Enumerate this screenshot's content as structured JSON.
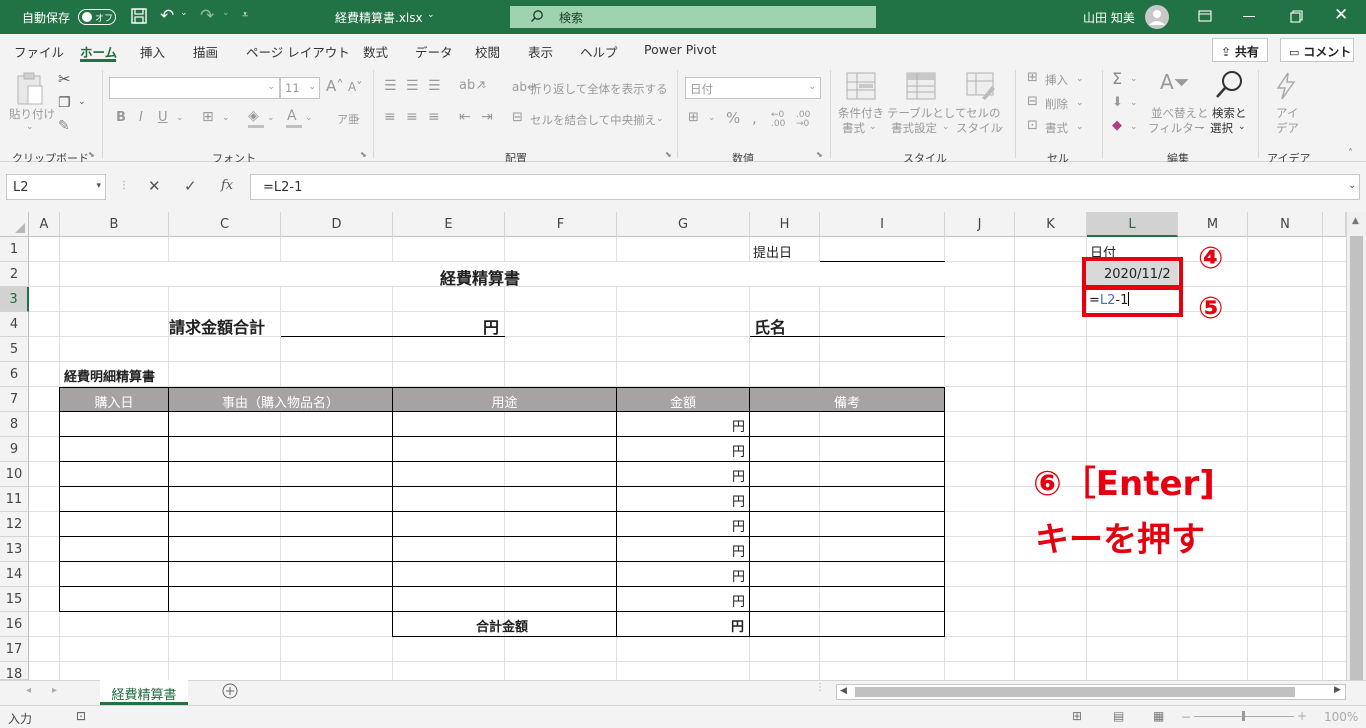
{
  "titlebar": {
    "autosave_label": "自動保存",
    "autosave_state": "オフ",
    "filename": "経費精算書.xlsx",
    "search_placeholder": "検索",
    "user_name": "山田 知美"
  },
  "tabs": [
    "ファイル",
    "ホーム",
    "挿入",
    "描画",
    "ページ レイアウト",
    "数式",
    "データ",
    "校閲",
    "表示",
    "ヘルプ",
    "Power Pivot"
  ],
  "active_tab": "ホーム",
  "share_label": "共有",
  "comment_label": "コメント",
  "ribbon": {
    "paste_label": "貼り付け",
    "font_size": "11",
    "wrap_text": "折り返して全体を表示する",
    "merge_center": "セルを結合して中央揃え",
    "number_format": "日付",
    "cond_format_1": "条件付き",
    "cond_format_2": "書式",
    "table_format_1": "テーブルとして",
    "table_format_2": "書式設定",
    "cell_style_1": "セルの",
    "cell_style_2": "スタイル",
    "insert": "挿入",
    "delete": "削除",
    "format": "書式",
    "sort_1": "並べ替えと",
    "sort_2": "フィルター",
    "find_1": "検索と",
    "find_2": "選択",
    "ideas_1": "アイ",
    "ideas_2": "デア",
    "groups": {
      "clipboard": "クリップボード",
      "font": "フォント",
      "alignment": "配置",
      "number": "数値",
      "styles": "スタイル",
      "cells": "セル",
      "editing": "編集",
      "ideas": "アイデア"
    }
  },
  "formula_bar": {
    "name_box": "L2",
    "formula": "=L2-1",
    "fx": "fx"
  },
  "columns": [
    "A",
    "B",
    "C",
    "D",
    "E",
    "F",
    "G",
    "H",
    "I",
    "J",
    "K",
    "L",
    "M",
    "N"
  ],
  "rows": [
    "1",
    "2",
    "3",
    "4",
    "5",
    "6",
    "7",
    "8",
    "9",
    "10",
    "11",
    "12",
    "13",
    "14",
    "15",
    "16",
    "17",
    "18"
  ],
  "sheet": {
    "submit_date_label": "提出日",
    "title": "経費精算書",
    "total_label": "請求金額合計",
    "yen": "円",
    "name_label": "氏名",
    "detail_title": "経費明細精算書",
    "headers": [
      "購入日",
      "事由（購入物品名）",
      "用途",
      "金額",
      "備考"
    ],
    "row_yen": [
      "円",
      "円",
      "円",
      "円",
      "円",
      "円",
      "円",
      "円"
    ],
    "sum_label": "合計金額",
    "sum_yen": "円",
    "l1": "日付",
    "l2": "2020/11/2",
    "l3_prefix": "=",
    "l3_ref": "L2",
    "l3_suffix": "-1"
  },
  "annotations": {
    "step4": "④",
    "step5": "⑤",
    "step6_line1": "⑥［Enter]",
    "step6_line2": "キーを押す",
    "color": "#e6000f"
  },
  "sheet_tab": "経費精算書",
  "status": {
    "mode": "入力",
    "zoom": "100%"
  }
}
